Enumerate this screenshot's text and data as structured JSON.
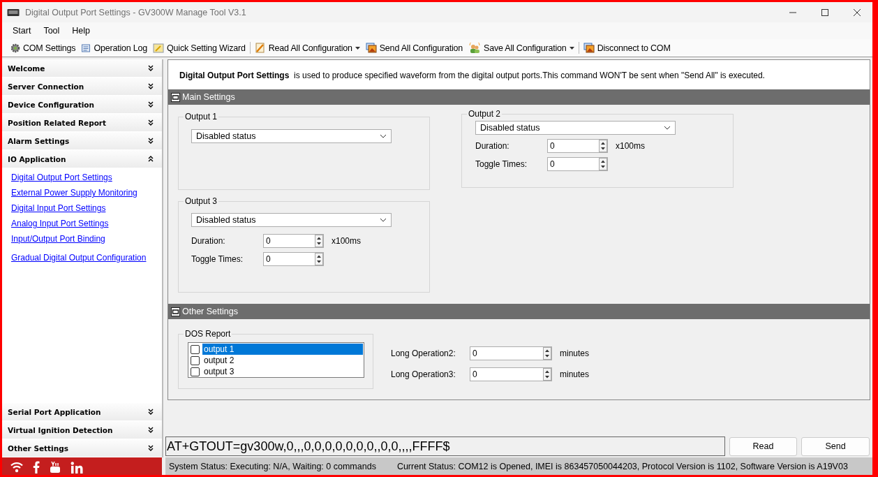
{
  "window": {
    "title": "Digital Output Port Settings - GV300W Manage Tool V3.1"
  },
  "menu": [
    "Start",
    "Tool",
    "Help"
  ],
  "toolbar": [
    {
      "label": "COM Settings",
      "kind": "gear",
      "dropdown": false
    },
    {
      "label": "Operation Log",
      "kind": "log",
      "dropdown": false
    },
    {
      "label": "Quick Setting Wizard",
      "kind": "wizard",
      "dropdown": false
    },
    {
      "label": "Read All Configuration",
      "kind": "read",
      "dropdown": true
    },
    {
      "label": "Send All Configuration",
      "kind": "send",
      "dropdown": false
    },
    {
      "label": "Save All Configuration",
      "kind": "save",
      "dropdown": true
    },
    {
      "label": "Disconnect to COM",
      "kind": "send",
      "dropdown": false
    }
  ],
  "sidebar": {
    "top_sections": [
      {
        "label": "Welcome",
        "expanded": false
      },
      {
        "label": "Server Connection",
        "expanded": false
      },
      {
        "label": "Device Configuration",
        "expanded": false
      },
      {
        "label": "Position Related Report",
        "expanded": false
      },
      {
        "label": "Alarm Settings",
        "expanded": false
      },
      {
        "label": "IO Application",
        "expanded": true,
        "children": [
          "Digital Output Port Settings",
          "External Power Supply Monitoring",
          "Digital Input Port Settings",
          "Analog Input Port Settings",
          "Input/Output Port Binding",
          "Gradual Digital Output Configuration"
        ]
      }
    ],
    "bottom_sections": [
      {
        "label": "Serial Port Application",
        "expanded": false
      },
      {
        "label": "Virtual Ignition Detection",
        "expanded": false
      },
      {
        "label": "Other Settings",
        "expanded": false
      }
    ]
  },
  "description": {
    "title": "Digital Output Port Settings",
    "text": "is used to produce specified waveform from the digital output ports.This command WON'T be sent when \"Send All\" is executed."
  },
  "main_settings": {
    "title": "Main Settings",
    "outputs": [
      {
        "title": "Output 1",
        "mode": "Disabled status"
      },
      {
        "title": "Output 2",
        "mode": "Disabled status",
        "duration_label": "Duration:",
        "duration": "0",
        "unit": "x100ms",
        "toggle_label": "Toggle Times:",
        "toggle": "0"
      },
      {
        "title": "Output 3",
        "mode": "Disabled status",
        "duration_label": "Duration:",
        "duration": "0",
        "unit": "x100ms",
        "toggle_label": "Toggle Times:",
        "toggle": "0"
      }
    ]
  },
  "other_settings": {
    "title": "Other Settings",
    "dos_report": {
      "title": "DOS Report",
      "items": [
        {
          "label": "output 1",
          "checked": false,
          "selected": true
        },
        {
          "label": "output 2",
          "checked": false,
          "selected": false
        },
        {
          "label": "output 3",
          "checked": false,
          "selected": false
        }
      ]
    },
    "fields": [
      {
        "label": "Long Operation2:",
        "value": "0",
        "unit": "minutes"
      },
      {
        "label": "Long Operation3:",
        "value": "0",
        "unit": "minutes"
      }
    ]
  },
  "command": {
    "value": "AT+GTOUT=gv300w,0,,,0,0,0,0,0,0,0,,0,0,,,,FFFF$",
    "buttons": [
      "Read",
      "Send"
    ]
  },
  "status_bar": {
    "system": "System Status:  Executing: N/A, Waiting: 0 commands",
    "current": "Current Status:  COM12 is Opened, IMEI is 863457050044203, Protocol Version is 1102, Software Version is A19V03"
  }
}
